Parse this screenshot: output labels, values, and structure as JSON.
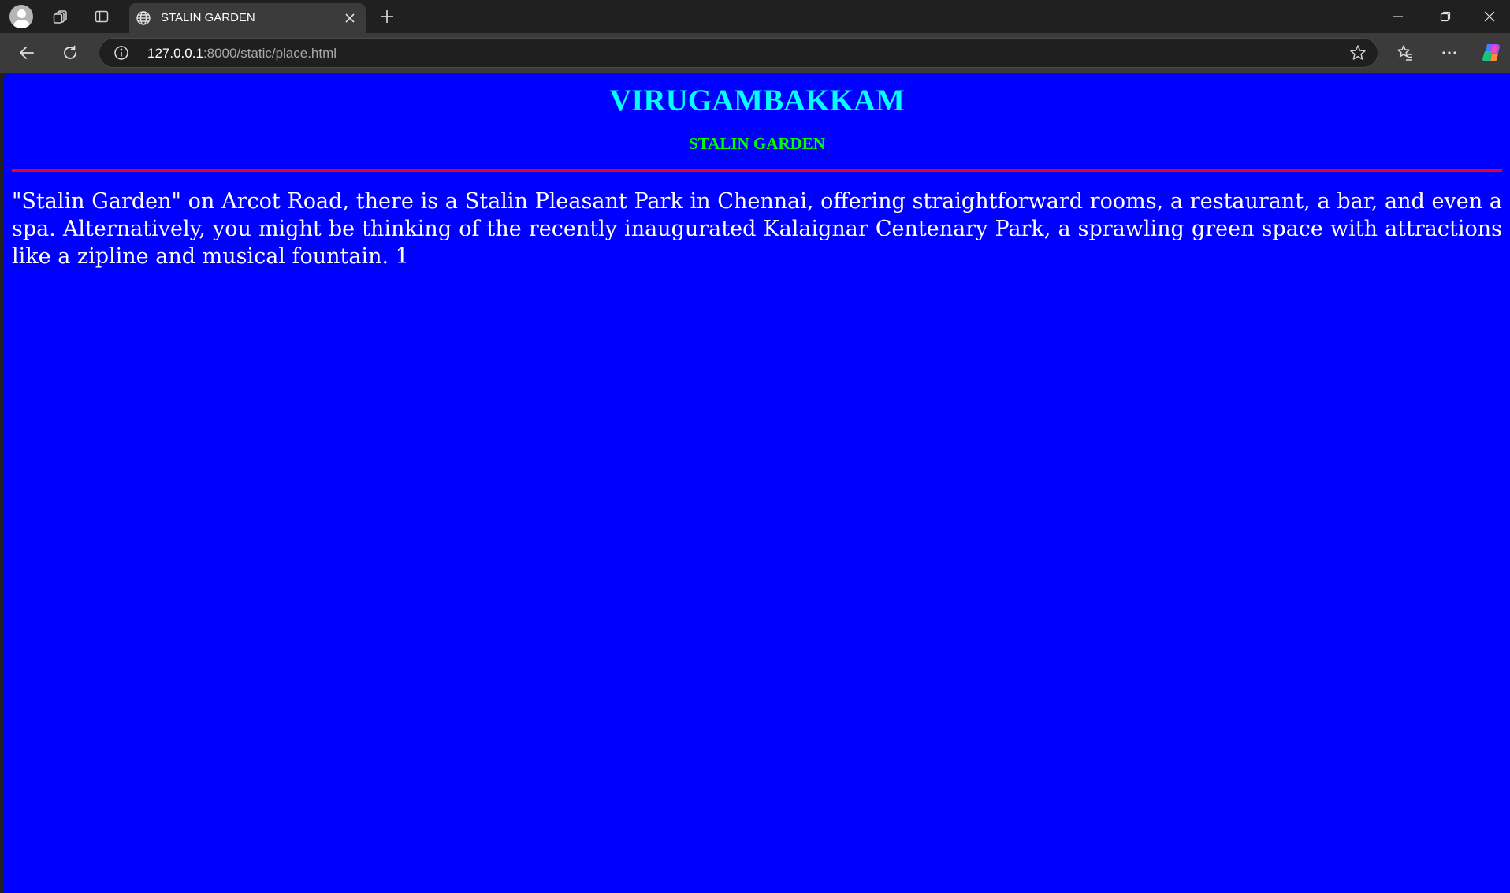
{
  "browser": {
    "tab": {
      "title": "STALIN GARDEN",
      "favicon": "globe-icon"
    },
    "address": {
      "host": "127.0.0.1",
      "rest": ":8000/static/place.html"
    },
    "icons": {
      "profile": "avatar-icon",
      "workspaces": "workspaces-icon",
      "tab_actions": "tab-actions-icon",
      "close_tab": "close-icon",
      "new_tab": "plus-icon",
      "minimize": "minimize-icon",
      "restore": "restore-icon",
      "close_window": "close-icon",
      "back": "back-arrow-icon",
      "refresh": "refresh-icon",
      "site_info": "info-icon",
      "favorite": "star-icon",
      "favorites": "favorites-icon",
      "menu": "more-icon",
      "copilot": "copilot-icon"
    },
    "colors": {
      "frame": "#202020",
      "toolbar": "#3b3b3b"
    }
  },
  "page": {
    "heading": "VIRUGAMBAKKAM",
    "subheading": "STALIN GARDEN",
    "paragraph": "\"Stalin Garden\" on Arcot Road, there is a Stalin Pleasant Park in Chennai, offering straightforward rooms, a restaurant, a bar, and even a spa. Alternatively, you might be thinking of the recently inaugurated Kalaignar Centenary Park, a sprawling green space with attractions like a zipline and musical fountain. 1",
    "colors": {
      "background": "#0000ff",
      "heading": "#00ffff",
      "subheading": "#00ff00",
      "rule": "#e8002a",
      "text": "#ffffff"
    }
  }
}
